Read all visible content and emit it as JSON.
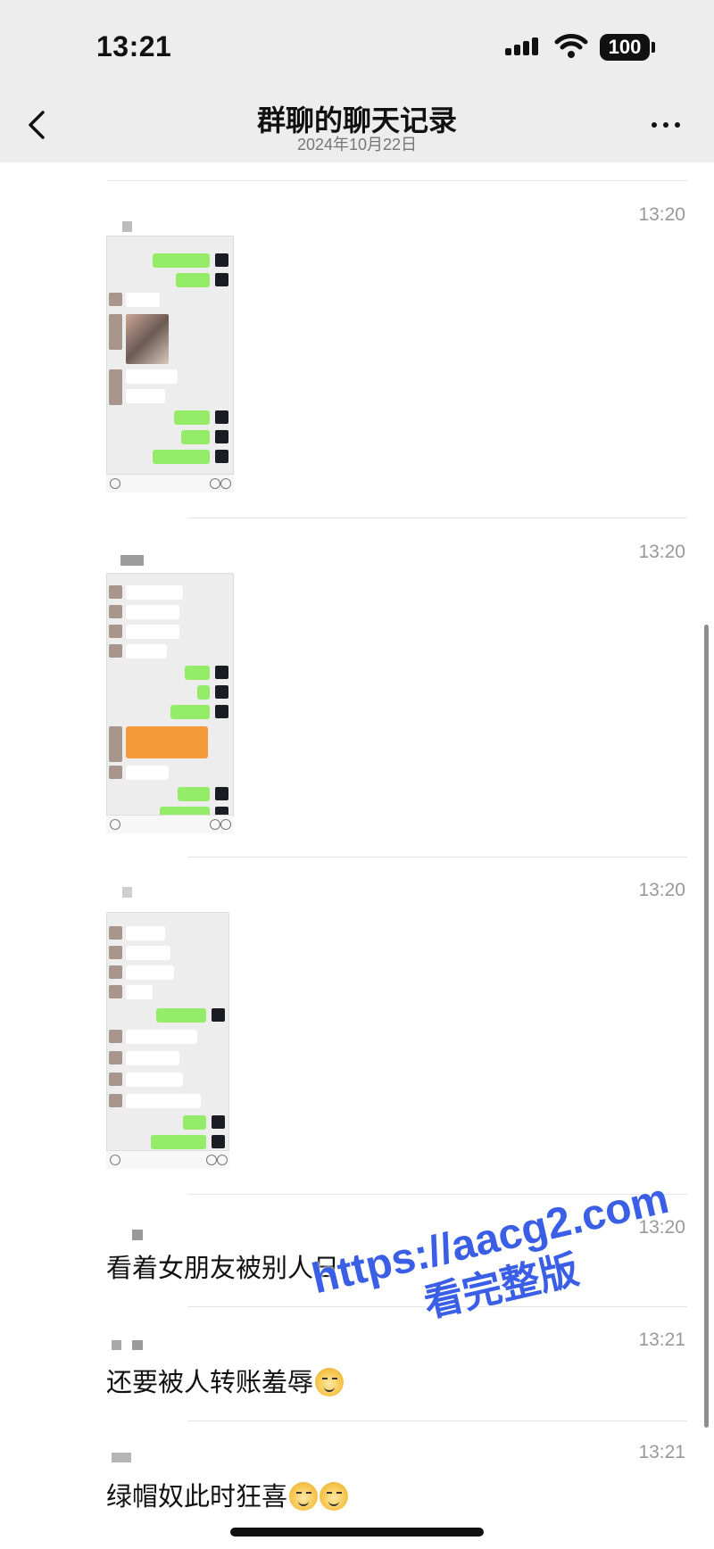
{
  "status_bar": {
    "time": "13:21",
    "battery": "100"
  },
  "nav": {
    "title": "群聊的聊天记录",
    "subtitle": "2024年10月22日"
  },
  "messages": [
    {
      "time": "13:20"
    },
    {
      "time": "13:20"
    },
    {
      "time": "13:20"
    },
    {
      "time": "13:20",
      "text": "看着女朋友被别人日"
    },
    {
      "time": "13:21",
      "text": "还要被人转账羞辱"
    },
    {
      "time": "13:21",
      "text": "绿帽奴此时狂喜"
    }
  ],
  "watermark": {
    "url": "https://aacg2.com",
    "text": "看完整版"
  },
  "icons": [
    "back-chevron-icon",
    "more-icon",
    "signal-icon",
    "wifi-icon",
    "battery-icon",
    "emoji-icon"
  ]
}
